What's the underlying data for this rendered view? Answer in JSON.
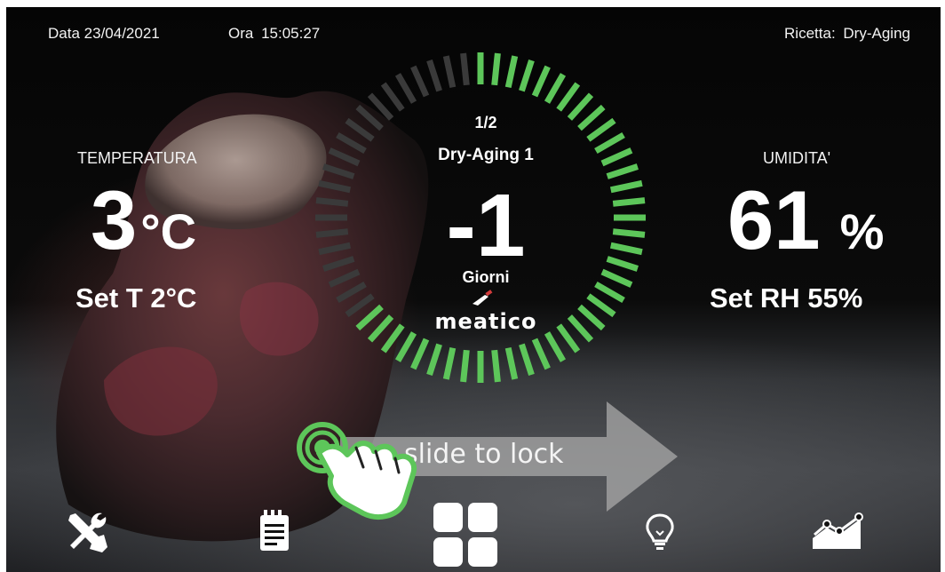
{
  "header": {
    "date_label": "Data",
    "date_value": "23/04/2021",
    "time_label": "Ora",
    "time_value": "15:05:27",
    "recipe_label": "Ricetta:",
    "recipe_value": "Dry-Aging"
  },
  "temperature": {
    "label": "TEMPERATURA",
    "value": "3",
    "unit": "°C",
    "set_text": "Set T  2°C"
  },
  "humidity": {
    "label": "UMIDITA'",
    "value": "61",
    "unit": "%",
    "set_text": "Set RH  55%"
  },
  "program": {
    "step": "1/2",
    "name": "Dry-Aging 1",
    "days_value": "-1",
    "days_unit": "Giorni",
    "brand": "meatico",
    "progress_fraction": 0.65,
    "active_color": "#5dc65a",
    "inactive_color": "#3a3a3a"
  },
  "slider": {
    "text": "slide to lock",
    "accent_color": "#5dc65a"
  },
  "nav": {
    "items": [
      {
        "icon": "tools-icon"
      },
      {
        "icon": "notepad-icon"
      },
      {
        "icon": "grid-menu-icon"
      },
      {
        "icon": "lightbulb-icon"
      },
      {
        "icon": "trend-chart-icon"
      }
    ]
  }
}
